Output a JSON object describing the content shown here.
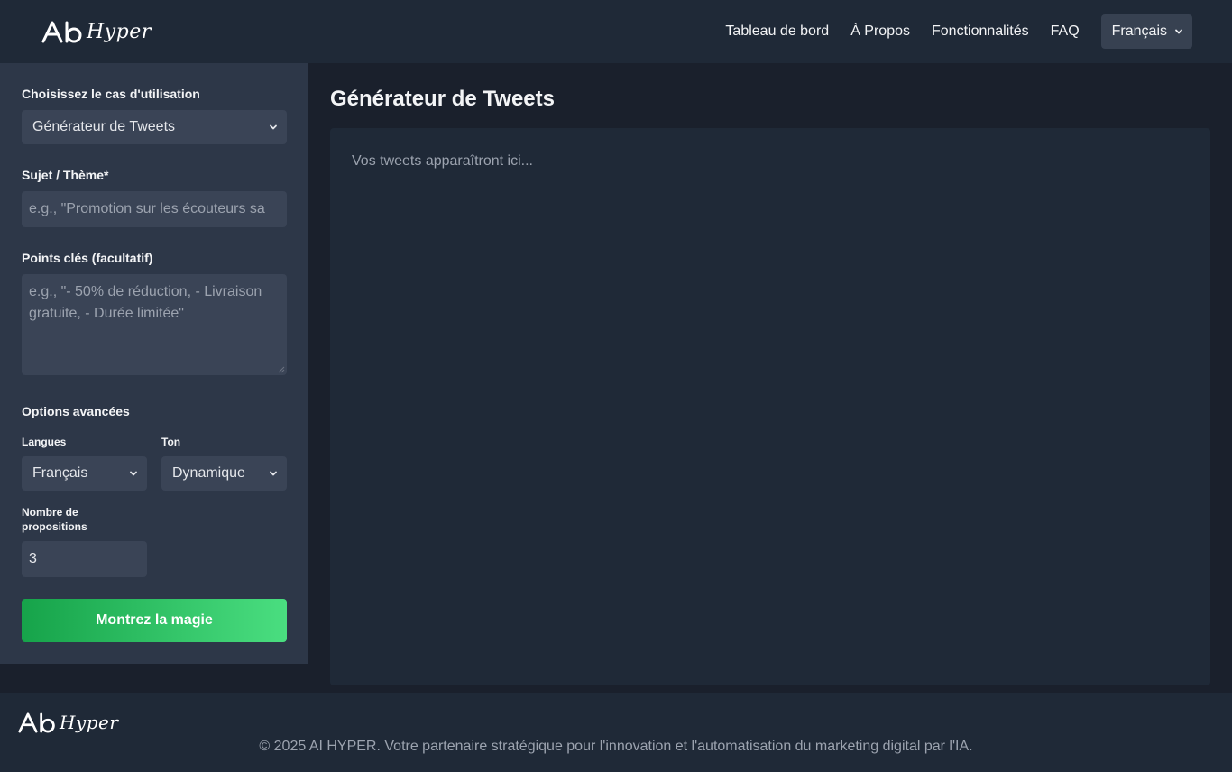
{
  "brand": {
    "logo_text": "Hyper"
  },
  "nav": {
    "items": [
      "Tableau de bord",
      "À Propos",
      "Fonctionnalités",
      "FAQ"
    ],
    "language": "Français"
  },
  "sidebar": {
    "usecase_label": "Choisissez le cas d'utilisation",
    "usecase_value": "Générateur de Tweets",
    "subject_label": "Sujet / Thème*",
    "subject_placeholder": "e.g., \"Promotion sur les écouteurs sa",
    "keypoints_label": "Points clés (facultatif)",
    "keypoints_placeholder": "e.g., \"- 50% de réduction, - Livraison gratuite, - Durée limitée\"",
    "advanced_label": "Options avancées",
    "languages_label": "Langues",
    "languages_value": "Français",
    "tone_label": "Ton",
    "tone_value": "Dynamique",
    "count_label": "Nombre de propositions",
    "count_value": "3",
    "submit_label": "Montrez la magie"
  },
  "main": {
    "title": "Générateur de Tweets",
    "output_placeholder": "Vos tweets apparaîtront ici..."
  },
  "footer": {
    "logo_text": "Hyper",
    "copyright": "© 2025 AI HYPER. Votre partenaire stratégique pour l'innovation et l'automatisation du marketing digital par l'IA."
  },
  "colors": {
    "accent_start": "#16a34a",
    "accent_end": "#4ade80",
    "header_bg": "#1f2937",
    "sidebar_bg": "#2d3748"
  }
}
